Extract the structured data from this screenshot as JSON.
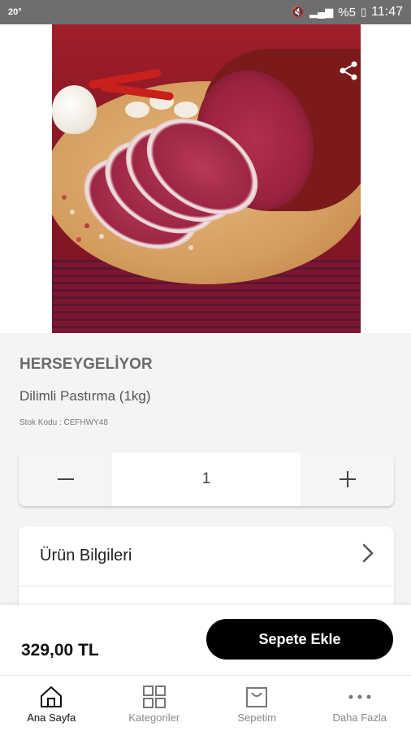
{
  "status_bar": {
    "temperature": "20°",
    "battery": "%5",
    "time": "11:47"
  },
  "hero": {
    "image_alt": "Dilimli Pastırma"
  },
  "product": {
    "brand": "HERSEYGELİYOR",
    "name": "Dilimli Pastırma (1kg)",
    "stock_code": "Stok Kodu : CEFHWY48"
  },
  "quantity": {
    "value": "1",
    "minus": "−",
    "plus": "+"
  },
  "info": {
    "product_info_label": "Ürün Bilgileri"
  },
  "purchase": {
    "price": "329,00 TL",
    "add_to_cart": "Sepete Ekle"
  },
  "tabs": [
    {
      "label": "Ana Sayfa",
      "icon": "home-icon"
    },
    {
      "label": "Kategoriler",
      "icon": "grid-icon"
    },
    {
      "label": "Sepetim",
      "icon": "bag-icon"
    },
    {
      "label": "Daha Fazla",
      "icon": "more-icon"
    }
  ]
}
